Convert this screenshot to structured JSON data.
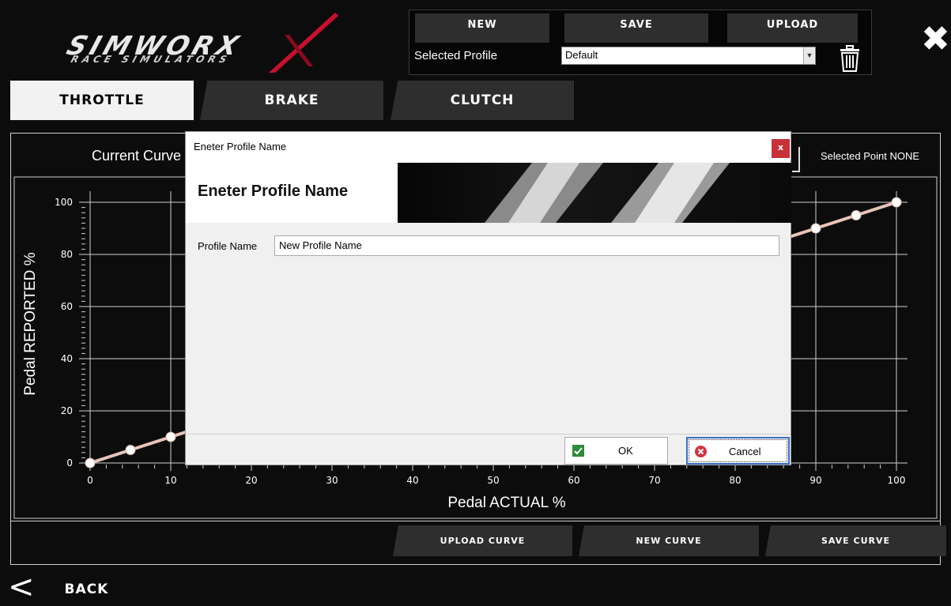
{
  "app": {
    "logo_text": "SIMWORX",
    "logo_subtext": "RACE SIMULATORS"
  },
  "profile": {
    "new_label": "NEW",
    "save_label": "SAVE",
    "upload_label": "UPLOAD",
    "selected_label": "Selected Profile",
    "selected_value": "Default"
  },
  "tabs": [
    {
      "label": "THROTTLE",
      "active": true
    },
    {
      "label": "BRAKE",
      "active": false
    },
    {
      "label": "CLUTCH",
      "active": false
    }
  ],
  "chart_header": {
    "title": "Current Curve",
    "selected_point": "Selected Point NONE"
  },
  "chart_data": {
    "type": "line",
    "xlabel": "Pedal ACTUAL %",
    "ylabel": "Pedal REPORTED %",
    "xlim": [
      0,
      100
    ],
    "ylim": [
      0,
      100
    ],
    "x_ticks": [
      "0",
      "10",
      "20",
      "30",
      "40",
      "50",
      "60",
      "70",
      "80",
      "90",
      "100"
    ],
    "y_ticks": [
      "0",
      "20",
      "40",
      "60",
      "80",
      "100"
    ],
    "grid": true,
    "series": [
      {
        "x": [
          0,
          5,
          10,
          90,
          95,
          100
        ],
        "y": [
          0,
          5,
          10,
          90,
          95,
          100
        ]
      }
    ]
  },
  "bottom_buttons": {
    "upload_curve": "UPLOAD CURVE",
    "new_curve": "NEW CURVE",
    "save_curve": "SAVE CURVE"
  },
  "nav": {
    "back_label": "BACK"
  },
  "dialog": {
    "title": "Eneter Profile Name",
    "heading": "Eneter Profile Name",
    "close_label": "x",
    "field_label": "Profile Name",
    "field_value": "New Profile Name",
    "ok_label": "OK",
    "cancel_label": "Cancel"
  },
  "colors": {
    "accent_red": "#c8102e",
    "curve": "#e8c4b8",
    "button_dark": "#2e2e2e"
  }
}
